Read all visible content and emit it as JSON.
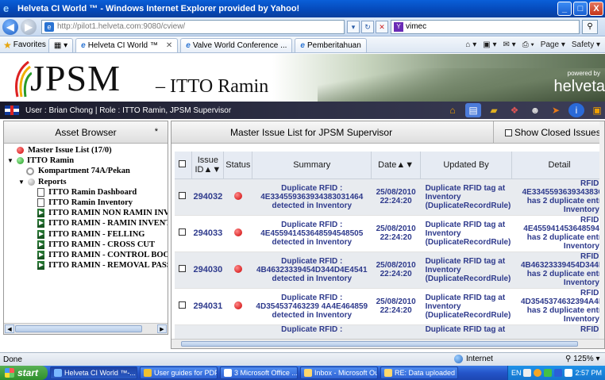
{
  "window": {
    "title": "Helveta CI World ™ - Windows Internet Explorer provided by Yahoo!",
    "controls": [
      "_",
      "□",
      "X"
    ]
  },
  "address_bar": {
    "url": "http://pilot1.helveta.com:9080/cview/",
    "search_text": "vimec"
  },
  "favorites_bar": {
    "favorites_label": "Favorites",
    "tabs": [
      {
        "label": "Helveta CI World ™",
        "active": true
      },
      {
        "label": "Valve World Conference ...",
        "active": false
      },
      {
        "label": "Pemberitahuan",
        "active": false
      }
    ],
    "commands": [
      "Page ▾",
      "Safety ▾"
    ]
  },
  "banner": {
    "brand": "JPSM",
    "subtitle": "– ITTO Ramin",
    "powered_by": "powered by",
    "helveta": "helveta"
  },
  "user_bar": {
    "text": "User : Brian Chong  |  Role : ITTO Ramin, JPSM Supervisor"
  },
  "asset_browser": {
    "title": "Asset Browser",
    "pin": "*",
    "tree": [
      {
        "label": "Master Issue List (17/0)",
        "icon": "red-dot",
        "indent": 0
      },
      {
        "label": "ITTO Ramin",
        "icon": "green-dot",
        "indent": 0,
        "expander": "▼"
      },
      {
        "label": "Kompartment 74A/Pekan",
        "icon": "ring",
        "indent": 1
      },
      {
        "label": "Reports",
        "icon": "gray-dot",
        "indent": 1,
        "expander": "▼"
      },
      {
        "label": "ITTO Ramin Dashboard",
        "icon": "doc",
        "indent": 2
      },
      {
        "label": "ITTO Ramin Inventory",
        "icon": "doc",
        "indent": 2
      },
      {
        "label": "ITTO RAMIN NON RAMIN INV",
        "icon": "report",
        "indent": 2
      },
      {
        "label": "ITTO RAMIN - RAMIN INVENT",
        "icon": "report",
        "indent": 2
      },
      {
        "label": "ITTO RAMIN - FELLING",
        "icon": "report",
        "indent": 2
      },
      {
        "label": "ITTO RAMIN - CROSS CUT",
        "icon": "report",
        "indent": 2
      },
      {
        "label": "ITTO RAMIN - CONTROL BOO",
        "icon": "report",
        "indent": 2
      },
      {
        "label": "ITTO RAMIN - REMOVAL PASS",
        "icon": "report",
        "indent": 2
      }
    ]
  },
  "issue_panel": {
    "title": "Master Issue List for JPSM Supervisor",
    "show_closed_label": "Show Closed Issues",
    "columns": {
      "issue_id": "Issue ID▲▼",
      "status": "Status",
      "summary": "Summary",
      "date": "Date▲▼",
      "updated_by": "Updated By",
      "detail": "Detail"
    },
    "rows": [
      {
        "id": "294032",
        "summary_line1": "Duplicate RFID :",
        "summary_line2": "4E334559363934383031464",
        "summary_line3": "detected in Inventory",
        "date": "25/08/2010",
        "time": "22:24:20",
        "updated_line1": "Duplicate RFID tag at",
        "updated_line2": "Inventory",
        "updated_line3": "(DuplicateRecordRule)",
        "detail_line1": "RFID :",
        "detail_line2": "4E334559363934383C",
        "detail_line3": "has 2 duplicate entri",
        "detail_line4": "Inventory ."
      },
      {
        "id": "294033",
        "summary_line1": "Duplicate RFID :",
        "summary_line2": "4E455941453648594548505",
        "summary_line3": "detected in Inventory",
        "date": "25/08/2010",
        "time": "22:24:20",
        "updated_line1": "Duplicate RFID tag at",
        "updated_line2": "Inventory",
        "updated_line3": "(DuplicateRecordRule)",
        "detail_line1": "RFID :",
        "detail_line2": "4E4559414536485945",
        "detail_line3": "has 2 duplicate entri",
        "detail_line4": "Inventory ."
      },
      {
        "id": "294030",
        "summary_line1": "Duplicate RFID :",
        "summary_line2": "4B46323339454D344D4E4541",
        "summary_line3": "detected in Inventory",
        "date": "25/08/2010",
        "time": "22:24:20",
        "updated_line1": "Duplicate RFID tag at",
        "updated_line2": "Inventory",
        "updated_line3": "(DuplicateRecordRule)",
        "detail_line1": "RFID :",
        "detail_line2": "4B46323339454D344E",
        "detail_line3": "has 2 duplicate entri",
        "detail_line4": "Inventory ."
      },
      {
        "id": "294031",
        "summary_line1": "Duplicate RFID :",
        "summary_line2": "4D354537463239 4A4E464859",
        "summary_line3": "detected in Inventory",
        "date": "25/08/2010",
        "time": "22:24:20",
        "updated_line1": "Duplicate RFID tag at",
        "updated_line2": "Inventory",
        "updated_line3": "(DuplicateRecordRule)",
        "detail_line1": "RFID :",
        "detail_line2": "4D3545374632394A4E",
        "detail_line3": "has 2 duplicate entri",
        "detail_line4": "Inventory ."
      }
    ],
    "partial_row": {
      "summary": "Duplicate RFID :",
      "updated": "Duplicate RFID tag at",
      "detail": "RFID :"
    }
  },
  "status_bar": {
    "text": "Done",
    "zone": "Internet",
    "zoom": "125%"
  },
  "taskbar": {
    "start": "start",
    "tasks": [
      "Helveta CI World ™-...",
      "User guides for PDPM",
      "3 Microsoft Office ...",
      "Inbox - Microsoft Ou...",
      "RE: Data uploaded b..."
    ],
    "language": "EN",
    "clock": "2:57 PM"
  }
}
